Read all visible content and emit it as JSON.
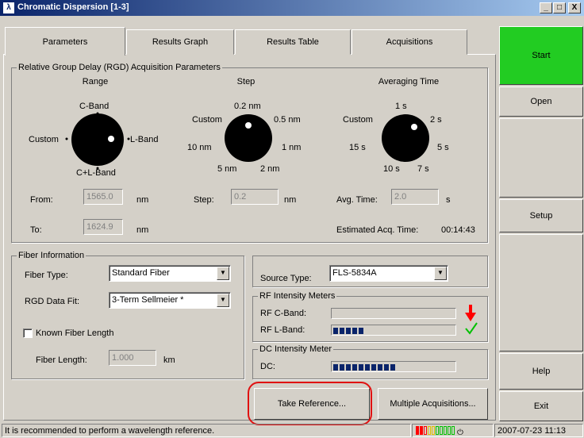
{
  "window": {
    "title": "Chromatic Dispersion [1-3]",
    "app_icon": "lambda-icon",
    "controls": {
      "minimize": "_",
      "maximize": "□",
      "close": "X"
    }
  },
  "tabs": [
    {
      "label": "Parameters",
      "active": true
    },
    {
      "label": "Results Graph"
    },
    {
      "label": "Results Table"
    },
    {
      "label": "Acquisitions"
    }
  ],
  "rgd": {
    "title": "Relative Group Delay (RGD) Acquisition Parameters",
    "range": {
      "heading": "Range",
      "top": "C-Band",
      "left": "Custom",
      "right": "L-Band",
      "bottom": "C+L-Band",
      "selected": "L-Band"
    },
    "step": {
      "heading": "Step",
      "top": "0.2 nm",
      "upper_left": "Custom",
      "upper_right": "0.5 nm",
      "left": "10 nm",
      "right": "1 nm",
      "lower_left": "5 nm",
      "lower_right": "2 nm",
      "selected": "0.2 nm"
    },
    "avg": {
      "heading": "Averaging Time",
      "top": "1 s",
      "upper_left": "Custom",
      "upper_right": "2 s",
      "left": "15 s",
      "right": "5 s",
      "lower_left": "10 s",
      "lower_right": "7 s",
      "selected": "2 s"
    },
    "from_label": "From:",
    "from_value": "1565.0",
    "from_unit": "nm",
    "to_label": "To:",
    "to_value": "1624.9",
    "to_unit": "nm",
    "step_label": "Step:",
    "step_value": "0.2",
    "step_unit": "nm",
    "avg_label": "Avg. Time:",
    "avg_value": "2.0",
    "avg_unit": "s",
    "est_label": "Estimated Acq. Time:",
    "est_value": "00:14:43"
  },
  "fiber": {
    "title": "Fiber Information",
    "type_label": "Fiber Type:",
    "type_value": "Standard Fiber",
    "fit_label": "RGD Data Fit:",
    "fit_value": "3-Term Sellmeier *",
    "known_label": "Known Fiber Length",
    "known_checked": false,
    "length_label": "Fiber Length:",
    "length_value": "1.000",
    "length_unit": "km"
  },
  "source": {
    "label": "Source Type:",
    "value": "FLS-5834A"
  },
  "rf": {
    "title": "RF Intensity Meters",
    "c_label": "RF C-Band:",
    "c_level": 0,
    "c_status": "down-arrow-icon",
    "c_color": "#ff0000",
    "l_label": "RF L-Band:",
    "l_level": 5,
    "l_status": "checkmark-icon",
    "l_color": "#00c000"
  },
  "dc": {
    "title": "DC Intensity Meter",
    "label": "DC:",
    "level": 10
  },
  "buttons": {
    "take_reference": "Take Reference...",
    "multiple": "Multiple Acquisitions..."
  },
  "side": {
    "start": "Start",
    "open": "Open",
    "setup": "Setup",
    "help": "Help",
    "exit": "Exit",
    "start_color": "#22cc22"
  },
  "highlight_color": "#e01010",
  "status": {
    "message": "It is recommended to perform a wavelength reference.",
    "datetime": "2007-07-23 11:13"
  }
}
